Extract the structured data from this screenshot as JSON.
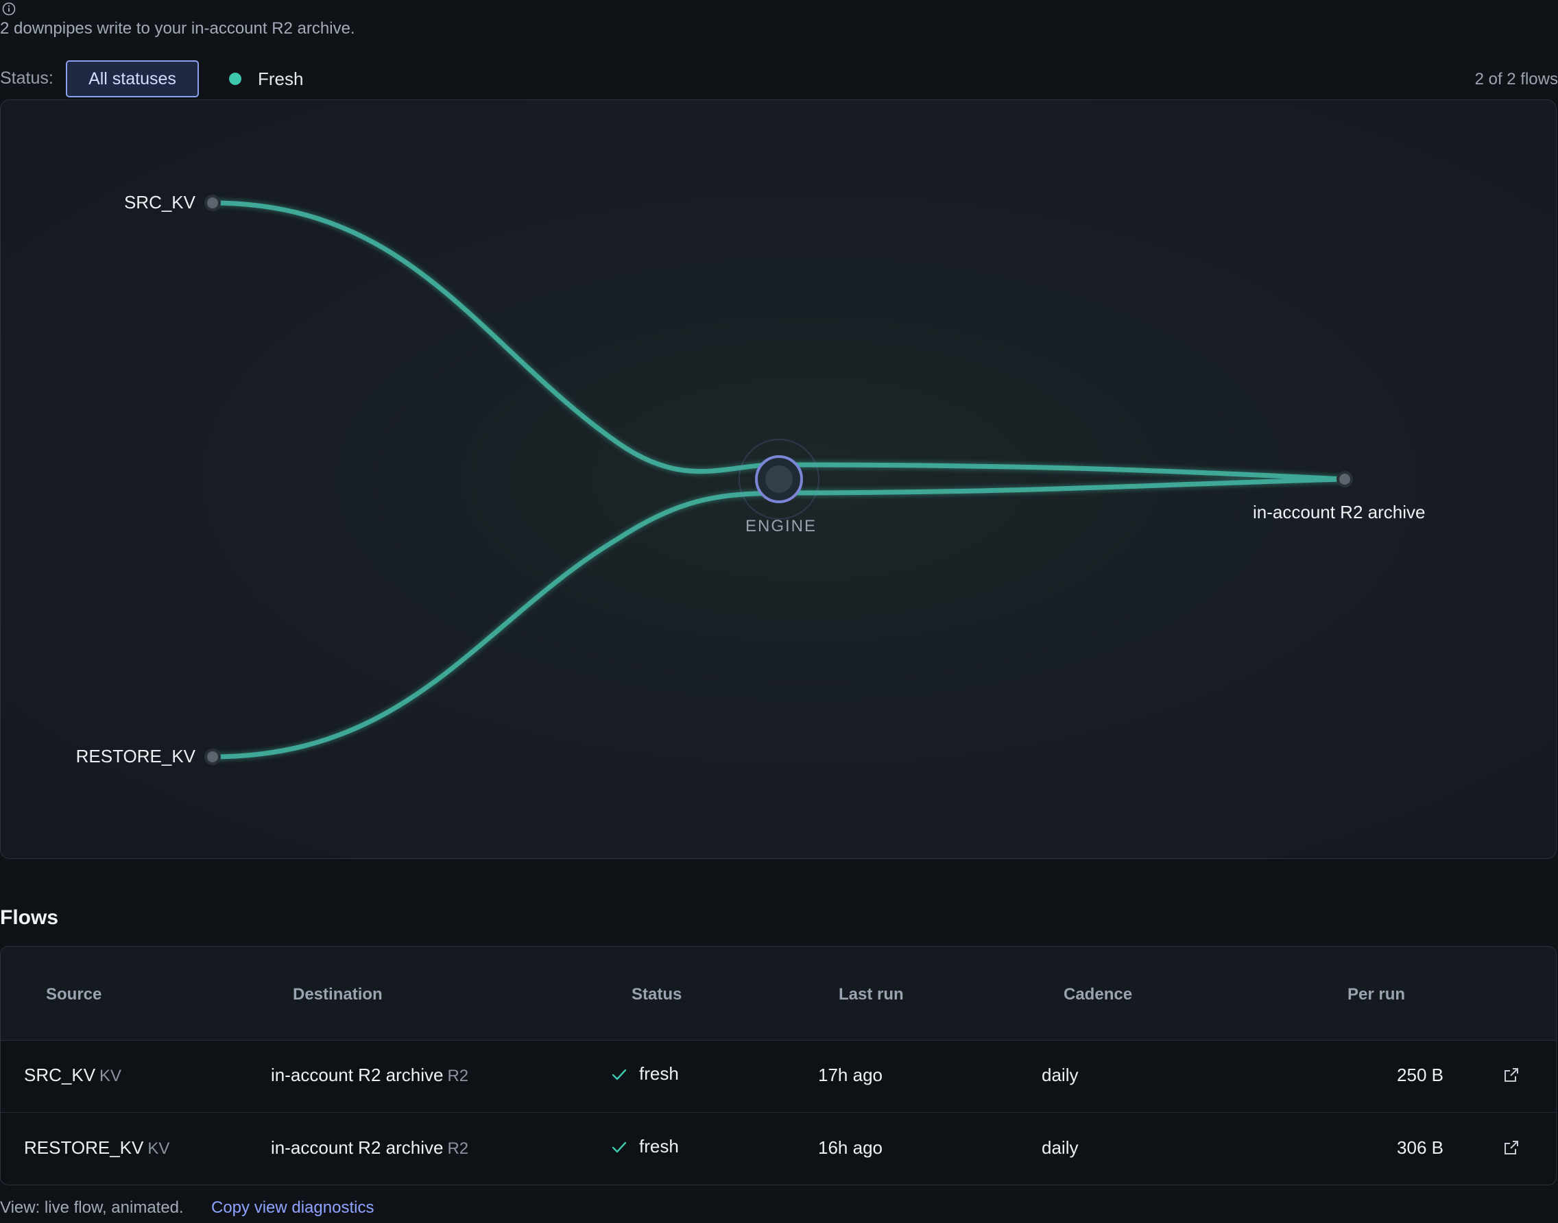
{
  "header": {
    "info_icon": "info-circle-icon",
    "subtitle": "2 downpipes write to your in-account R2 archive."
  },
  "filters": {
    "status_label": "Status:",
    "all_statuses": "All statuses",
    "fresh": "Fresh",
    "fresh_color": "#3ec8ad",
    "count": "2 of 2 flows"
  },
  "diagram": {
    "sources": [
      "SRC_KV",
      "RESTORE_KV"
    ],
    "engine_label": "ENGINE",
    "destination": "in-account R2 archive",
    "flow_color": "#3fa896",
    "engine_color": "#7b86d6"
  },
  "flows": {
    "title": "Flows",
    "columns": [
      "Source",
      "Destination",
      "Status",
      "Last run",
      "Cadence",
      "Per run"
    ],
    "rows": [
      {
        "source": "SRC_KV",
        "source_type": "KV",
        "destination": "in-account R2 archive",
        "dest_type": "R2",
        "status": "fresh",
        "last_run": "17h ago",
        "cadence": "daily",
        "per_run": "250 B"
      },
      {
        "source": "RESTORE_KV",
        "source_type": "KV",
        "destination": "in-account R2 archive",
        "dest_type": "R2",
        "status": "fresh",
        "last_run": "16h ago",
        "cadence": "daily",
        "per_run": "306 B"
      }
    ]
  },
  "footer": {
    "view_text": "View: live flow, animated.",
    "copy_link": "Copy view diagnostics"
  }
}
